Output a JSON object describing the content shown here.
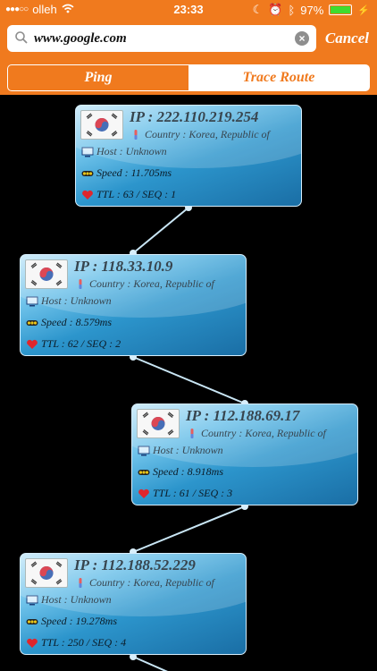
{
  "status_bar": {
    "carrier": "olleh",
    "time": "23:33",
    "battery": "97%",
    "battery_level": 0.97,
    "colors": {
      "bar": "#f07a1e",
      "battery_fill": "#3fdc2f"
    }
  },
  "search": {
    "value": "www.google.com",
    "cancel_label": "Cancel"
  },
  "tabs": [
    {
      "label": "Ping",
      "selected": true
    },
    {
      "label": "Trace Route",
      "selected": false
    }
  ],
  "hops": [
    {
      "ip": "IP : 222.110.219.254",
      "country": "Country : Korea, Republic of",
      "host": "Host : Unknown",
      "speed": "Speed : 11.705ms",
      "ttl": "TTL : 63 / SEQ : 1"
    },
    {
      "ip": "IP : 118.33.10.9",
      "country": "Country : Korea, Republic of",
      "host": "Host : Unknown",
      "speed": "Speed : 8.579ms",
      "ttl": "TTL : 62 / SEQ : 2"
    },
    {
      "ip": "IP : 112.188.69.17",
      "country": "Country : Korea, Republic of",
      "host": "Host : Unknown",
      "speed": "Speed : 8.918ms",
      "ttl": "TTL : 61 / SEQ : 3"
    },
    {
      "ip": "IP : 112.188.52.229",
      "country": "Country : Korea, Republic of",
      "host": "Host : Unknown",
      "speed": "Speed : 19.278ms",
      "ttl": "TTL : 250 / SEQ : 4"
    }
  ],
  "icons": {
    "search": "search-icon",
    "clear": "clear-icon",
    "flag": "korea-flag-icon",
    "country": "pin-icon",
    "host": "computer-icon",
    "speed": "speed-light-icon",
    "ttl": "heart-icon"
  }
}
